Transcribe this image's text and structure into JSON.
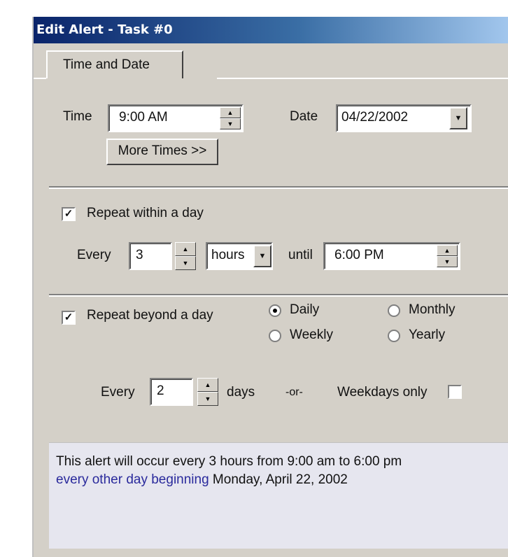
{
  "window": {
    "title": "Edit Alert - Task #0"
  },
  "tabs": [
    {
      "label": "Time and Date",
      "active": true
    }
  ],
  "time_section": {
    "time_label": "Time",
    "time_value": "9:00 AM",
    "date_label": "Date",
    "date_value": "04/22/2002",
    "more_times_button": "More Times >>"
  },
  "repeat_day": {
    "checked": true,
    "label": "Repeat within a day",
    "every_label": "Every",
    "every_value": "3",
    "unit_value": "hours",
    "until_label": "until",
    "until_value": "6:00 PM"
  },
  "repeat_beyond": {
    "checked": true,
    "label": "Repeat beyond a day",
    "options": [
      {
        "label": "Daily",
        "selected": true
      },
      {
        "label": "Weekly",
        "selected": false
      },
      {
        "label": "Monthly",
        "selected": false
      },
      {
        "label": "Yearly",
        "selected": false
      }
    ],
    "every_label": "Every",
    "every_value": "2",
    "days_label": "days",
    "or_label": "-or-",
    "weekdays_label": "Weekdays only",
    "weekdays_checked": false
  },
  "summary": {
    "line1": "This alert will occur every 3 hours from 9:00 am to 6:00 pm",
    "line2_highlight": "every other day beginning",
    "line2_rest": " Monday, April 22, 2002"
  }
}
